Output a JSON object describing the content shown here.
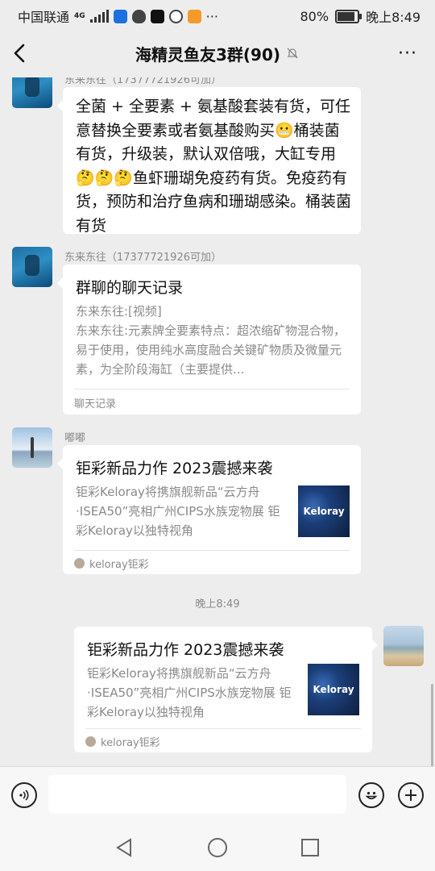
{
  "status_bar": {
    "carrier": "中国联通",
    "network": "4G",
    "battery": "80%",
    "time": "晚上8:49"
  },
  "nav": {
    "title": "海精灵鱼友3群(90)",
    "back_icon": "chevron-left-icon",
    "mute_icon": "bell-off-icon",
    "more_label": "···"
  },
  "messages": {
    "m1": {
      "sender": "东来东往（17377721926可加）",
      "text": "全菌 + 全要素 + 氨基酸套装有货，可任意替换全要素或者氨基酸购买😬桶装菌有货，升级装，默认双倍哦，大缸专用🤔🤔🤔鱼虾珊瑚免疫药有货。免疫药有货，预防和治疗鱼病和珊瑚感染。桶装菌有货"
    },
    "m2": {
      "sender": "东来东往（17377721926可加）",
      "title": "群聊的聊天记录",
      "line1": "东来东往:[视频]",
      "line2": "东来东往:元素牌全要素特点：超浓缩矿物混合物，易于使用，使用纯水高度融合关键矿物质及微量元素，为全阶段海缸（主要提供...",
      "footer": "聊天记录"
    },
    "m3": {
      "sender": "嘟嘟",
      "title": "钜彩新品力作 2023震撼来袭",
      "desc": "钜彩Keloray将携旗舰新品“云方舟·ISEA50”亮相广州CIPS水族宠物展 钜彩Keloray以独特视角",
      "thumb_text": "Keloray",
      "source": "keloray钜彩"
    },
    "time_separator": "晚上8:49",
    "m4": {
      "title": "钜彩新品力作 2023震撼来袭",
      "desc": "钜彩Keloray将携旗舰新品“云方舟·ISEA50”亮相广州CIPS水族宠物展 钜彩Keloray以独特视角",
      "thumb_text": "Keloray",
      "source": "keloray钜彩"
    }
  },
  "input_bar": {
    "voice_icon": "voice-icon",
    "message_value": "",
    "emoji_icon": "emoji-icon",
    "plus_icon": "plus-icon"
  },
  "system_nav": {
    "back_icon": "triangle-back-icon",
    "home_icon": "circle-home-icon",
    "recents_icon": "square-recents-icon"
  }
}
